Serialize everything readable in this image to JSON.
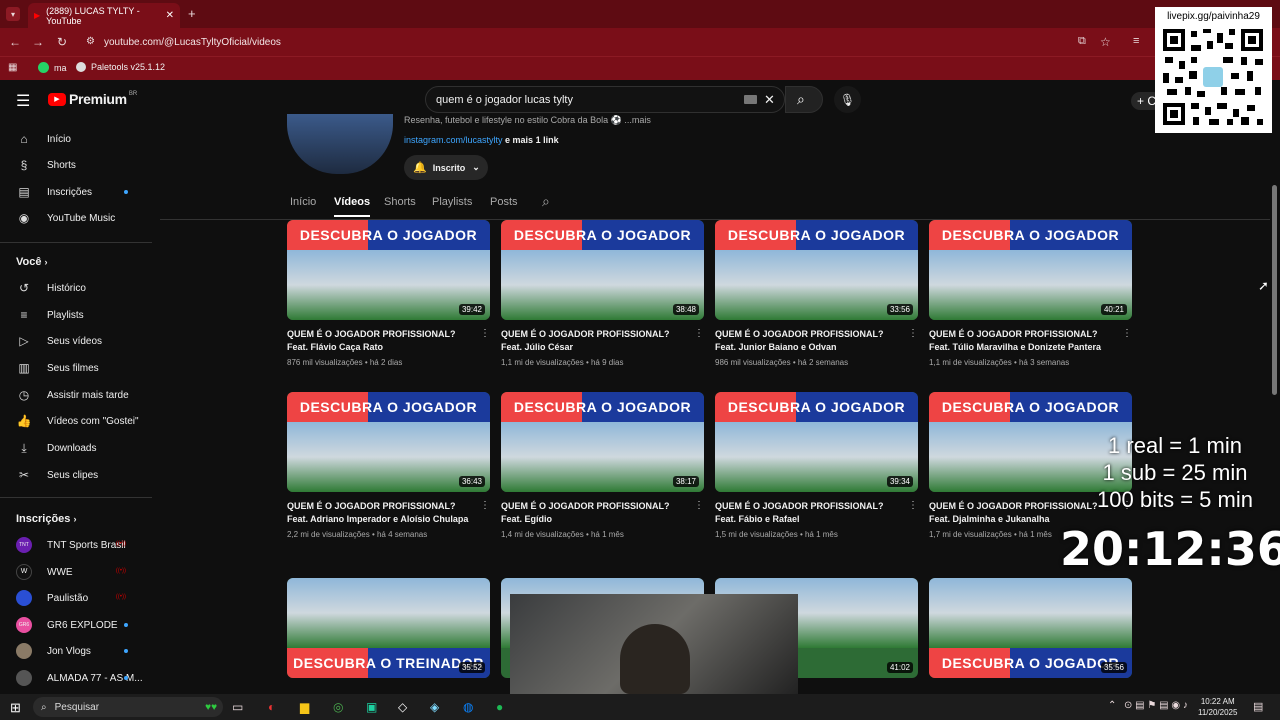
{
  "browser": {
    "tab_title": "(2889) LUCAS TYLTY - YouTube",
    "url": "youtube.com/@LucasTyltyOficial/videos",
    "bookmarks": [
      "ma",
      "Paletools v25.1.12"
    ]
  },
  "yt": {
    "logo": "Premium",
    "logo_region": "BR",
    "search_value": "quem é o jogador lucas tylty",
    "create_label": "+ C"
  },
  "sidebar": {
    "main": [
      {
        "label": "Início",
        "icon": "home-icon"
      },
      {
        "label": "Shorts",
        "icon": "shorts-icon"
      },
      {
        "label": "Inscrições",
        "icon": "subscriptions-icon"
      },
      {
        "label": "YouTube Music",
        "icon": "music-icon"
      }
    ],
    "you_title": "Você",
    "you": [
      {
        "label": "Histórico",
        "icon": "history-icon"
      },
      {
        "label": "Playlists",
        "icon": "playlists-icon"
      },
      {
        "label": "Seus vídeos",
        "icon": "your-videos-icon"
      },
      {
        "label": "Seus filmes",
        "icon": "movies-icon"
      },
      {
        "label": "Assistir mais tarde",
        "icon": "watch-later-icon"
      },
      {
        "label": "Vídeos com \"Gostei\"",
        "icon": "like-icon"
      },
      {
        "label": "Downloads",
        "icon": "download-icon"
      },
      {
        "label": "Seus clipes",
        "icon": "scissors-icon"
      }
    ],
    "subs_title": "Inscrições",
    "subs": [
      {
        "label": "TNT Sports Brasil",
        "avatar": "TNT"
      },
      {
        "label": "WWE",
        "avatar": "W"
      },
      {
        "label": "Paulistão",
        "avatar": ""
      },
      {
        "label": "GR6 EXPLODE",
        "avatar": "GR6"
      },
      {
        "label": "Jon Vlogs",
        "avatar": ""
      },
      {
        "label": "ALMADA 77 - AS M...",
        "avatar": ""
      }
    ]
  },
  "channel": {
    "description": "Resenha, futebol e lifestyle no estilo Cobra da Bola ⚽ ...mais",
    "link": "instagram.com/lucastylty",
    "link_more": "e mais 1 link",
    "subscribed": "Inscrito",
    "tabs": [
      "Início",
      "Vídeos",
      "Shorts",
      "Playlists",
      "Posts"
    ]
  },
  "videos": [
    {
      "banner": "DESCUBRA O JOGADOR",
      "duration": "39:42",
      "title": "QUEM É O JOGADOR PROFISSIONAL? Feat. Flávio Caça Rato",
      "views": "876 mil visualizações",
      "age": "há 2 dias"
    },
    {
      "banner": "DESCUBRA O JOGADOR",
      "duration": "38:48",
      "title": "QUEM É O JOGADOR PROFISSIONAL? Feat. Júlio César",
      "views": "1,1 mi de visualizações",
      "age": "há 9 dias"
    },
    {
      "banner": "DESCUBRA O JOGADOR",
      "duration": "33:56",
      "title": "QUEM É O JOGADOR PROFISSIONAL? Feat. Junior Baiano e Odvan",
      "views": "986 mil visualizações",
      "age": "há 2 semanas"
    },
    {
      "banner": "DESCUBRA O JOGADOR",
      "duration": "40:21",
      "title": "QUEM É O JOGADOR PROFISSIONAL? Feat. Túlio Maravilha e Donizete Pantera",
      "views": "1,1 mi de visualizações",
      "age": "há 3 semanas"
    },
    {
      "banner": "DESCUBRA O JOGADOR",
      "duration": "36:43",
      "title": "QUEM É O JOGADOR PROFISSIONAL? Feat. Adriano Imperador e Aloísio Chulapa",
      "views": "2,2 mi de visualizações",
      "age": "há 4 semanas"
    },
    {
      "banner": "DESCUBRA O JOGADOR",
      "duration": "38:17",
      "title": "QUEM É O JOGADOR PROFISSIONAL? Feat. Egídio",
      "views": "1,4 mi de visualizações",
      "age": "há 1 mês"
    },
    {
      "banner": "DESCUBRA O JOGADOR",
      "duration": "39:34",
      "title": "QUEM É O JOGADOR PROFISSIONAL? Feat. Fábio e Rafael",
      "views": "1,5 mi de visualizações",
      "age": "há 1 mês"
    },
    {
      "banner": "DESCUBRA O JOGADOR",
      "duration": "",
      "title": "QUEM É O JOGADOR PROFISSIONAL? Feat. Djalminha e Jukanalha",
      "views": "1,7 mi de visualizações",
      "age": "há 1 mês"
    },
    {
      "banner": "DESCUBRA O TREINADOR",
      "duration": "35:52",
      "title": "",
      "views": "",
      "age": ""
    },
    {
      "banner": "",
      "duration": "",
      "title": "",
      "views": "",
      "age": ""
    },
    {
      "banner": "",
      "duration": "41:02",
      "title": "",
      "views": "",
      "age": ""
    },
    {
      "banner": "DESCUBRA O JOGADOR",
      "duration": "35:56",
      "title": "",
      "views": "",
      "age": ""
    }
  ],
  "overlay": {
    "qr_url": "livepix.gg/paivinha29",
    "lines": [
      "1 real = 1 min",
      "1 sub = 25 min",
      "100 bits = 5 min"
    ],
    "timer": "20:12:36"
  },
  "taskbar": {
    "search": "Pesquisar",
    "time": "10:22 AM",
    "date": "11/20/2025"
  }
}
